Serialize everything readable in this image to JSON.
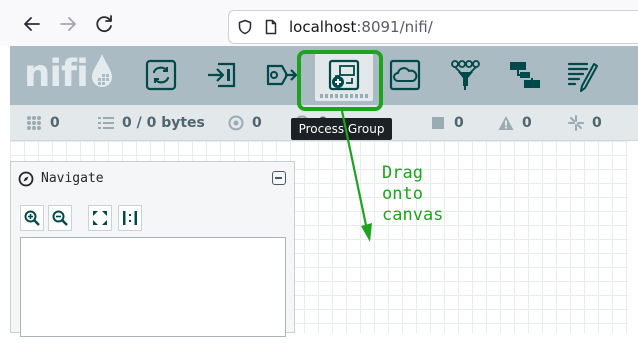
{
  "browser": {
    "url_host": "localhost",
    "url_rest": ":8091/nifi/"
  },
  "header": {
    "logo_text": "nifi",
    "tools": [
      {
        "name": "processor",
        "icon": "processor-icon"
      },
      {
        "name": "input-port",
        "icon": "input-port-icon"
      },
      {
        "name": "output-port",
        "icon": "output-port-icon"
      },
      {
        "name": "process-group",
        "icon": "process-group-icon",
        "selected": true
      },
      {
        "name": "remote-process-group",
        "icon": "remote-process-group-icon"
      },
      {
        "name": "funnel",
        "icon": "funnel-icon"
      },
      {
        "name": "template",
        "icon": "template-icon"
      },
      {
        "name": "label",
        "icon": "label-icon"
      }
    ]
  },
  "tooltip": {
    "text": "Process Group"
  },
  "status": {
    "active_threads": "0",
    "queued": "0 / 0 bytes",
    "transmitting": "0",
    "hidden_count": "0",
    "stopped": "0",
    "invalid": "0",
    "disabled": "0"
  },
  "annotation": {
    "line1": "Drag",
    "line2": "onto",
    "line3": "canvas",
    "color": "#1ea31e"
  },
  "navigate": {
    "title": "Navigate"
  },
  "colors": {
    "header_bg": "#aabbc3",
    "status_bg": "#e3e8eb",
    "icon_color": "#004849",
    "highlight": "#1ea31e"
  }
}
